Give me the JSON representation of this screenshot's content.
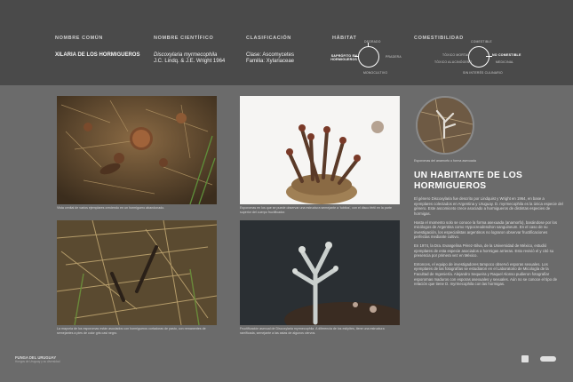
{
  "header": {
    "common_name": {
      "label": "NOMBRE COMÚN",
      "value": "XILARIA DE LOS HORMIGUEROS"
    },
    "scientific_name": {
      "label": "NOMBRE CIENTÍFICO",
      "value": "Discoxylaria myrmecophila",
      "authors": "J.C. Lindq. & J.E. Wright 1964"
    },
    "classification": {
      "label": "CLASIFICACIÓN",
      "class": "Clase: Ascomycetes",
      "family": "Familia: Xylariaceae"
    },
    "habitat": {
      "label": "HÁBITAT",
      "top": "DEGRADO",
      "left": "SAPRÓFITO EN HORMIGUEROS",
      "right": "PRADERA",
      "bottom": "MONOCULTIVO"
    },
    "edibility": {
      "label": "COMESTIBILIDAD",
      "top": "COMESTIBLE",
      "left": "TÓXICO MORTAL",
      "left2": "TÓXICO ALUCINÓGENO",
      "right": "NO COMESTIBLE",
      "right2": "MEDICINAL",
      "bottom": "SIN INTERÉS CULINARIO"
    }
  },
  "photos": [
    {
      "caption": "Vista cenital de varios ejemplares creciendo en un hormiguero abandonado."
    },
    {
      "caption": "Esporomas en los que se puede observar una estructura semejante a ‘tubitos’, con el disco fértil en la parte superior del cuerpo fructificador."
    },
    {
      "caption": "La mayoría de los esporomas están asociados con hormigueros cortadoras de pasto, con remanentes de semejantes a pies de color gris casi negro."
    },
    {
      "caption": "Fructificación asexual de Discoxylaria myrmecophila. A diferencia de los estípites, tiene una estructura ramificada, semejante a las astas de algunos ciervos."
    }
  ],
  "circle_caption": "Esporomas del anamorfo o forma asexuada",
  "article": {
    "title": "UN HABITANTE DE LOS HORMIGUEROS",
    "paragraphs": [
      "El género Discoxylaria fue descrito por Lindquist y Wright en 1964, en base a ejemplares colectados en Argentina y Uruguay. D. myrmecophila es la única especie del género. Este ascomiceto crece asociado a hormigueros de distintas especies de hormigas.",
      "Hasta el momento solo se conoce la forma asexuada (anamorfo), basándose por los micólogos de Argentina como Hypocreodendron sanguineum. En el caso de su investigación, los especialistas argentinos no lograron observar fructificaciones perfectas mediante cultivo.",
      "En 1974, la Dra. Evangelina Pérez-Silva, de la Universidad de México, estudió ejemplares de esta especie asociados a hormigas arrieras. Esto revivió el y citó su presencia por primera vez en México.",
      "Entonces, el equipo de investigadores tampoco observó esporas sexuales. Los ejemplares de las fotografías se estudiaron en el Laboratorio de Micología de la Facultad de Ingeniería. Alejandro Sequeira y Raquel Alonso pudieron fotografiar esporomas maduros con esporas asexuales y sexuales. Aún no se conoce el tipo de relación que tiene D. myrmecophila con las hormigas."
    ]
  },
  "footer": {
    "title": "FUNGA DEL URUGUAY",
    "subtitle": "Hongos de Uruguay y su diversidad"
  }
}
